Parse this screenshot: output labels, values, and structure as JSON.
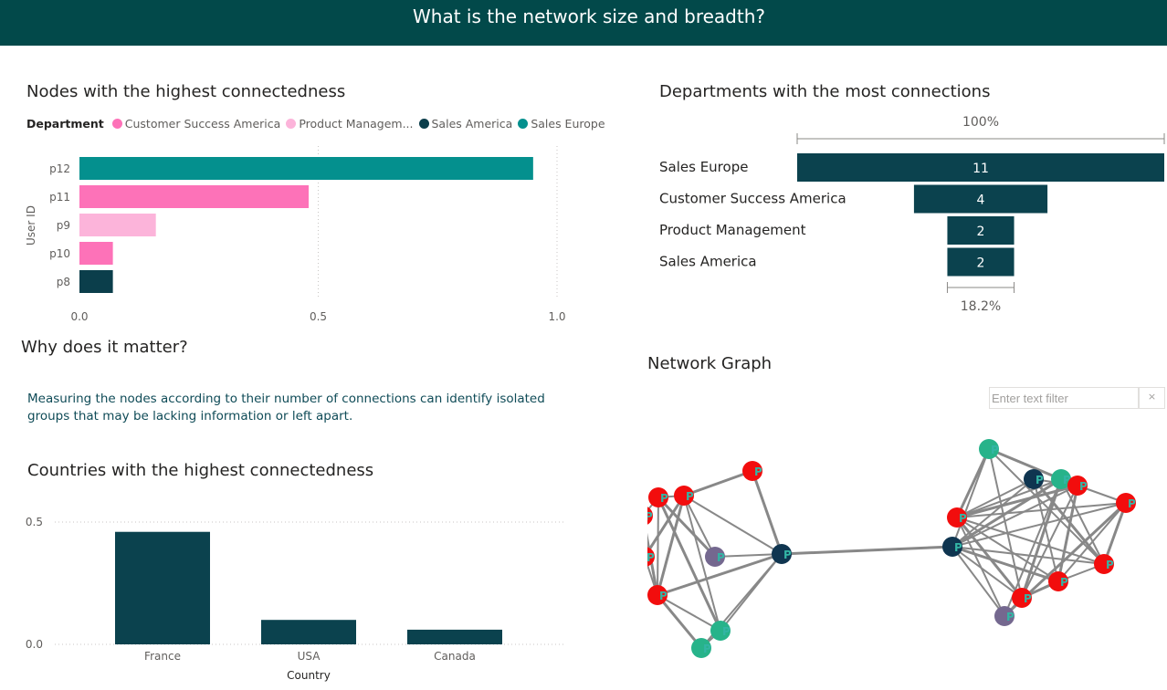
{
  "header": {
    "title": "What is the network size and breadth?"
  },
  "nodes_chart": {
    "title": "Nodes with the highest connectedness",
    "legend_title": "Department",
    "legend": [
      {
        "label": "Customer Success America",
        "color": "#fd72b8"
      },
      {
        "label": "Product Managem...",
        "color": "#fcb4da"
      },
      {
        "label": "Sales America",
        "color": "#0b3e4b"
      },
      {
        "label": "Sales Europe",
        "color": "#04908e"
      }
    ],
    "ylabel": "User ID"
  },
  "dept_chart": {
    "title": "Departments with the most connections",
    "top_pct": "100%",
    "bottom_pct": "18.2%"
  },
  "why": {
    "title": "Why does it matter?",
    "text": "Measuring the nodes according to their number of connections can identify isolated groups that may be lacking information or left apart."
  },
  "country_chart": {
    "title": "Countries with the highest connectedness",
    "xlabel": "Country"
  },
  "network": {
    "title": "Network Graph",
    "filter_placeholder": "Enter text filter",
    "clear_icon": "×",
    "node_colors": {
      "red": "#f20d0d",
      "green": "#27b38a",
      "navy": "#0f3550",
      "purple": "#74688f"
    },
    "labels": [
      "P",
      "P",
      "P",
      "P",
      "P",
      "P",
      "P",
      "P",
      "P",
      "P",
      "P",
      "P",
      "P",
      "P",
      "P",
      "P",
      "P",
      "P",
      "P",
      "P",
      "P",
      "P"
    ]
  },
  "chart_data": [
    {
      "type": "bar",
      "orientation": "horizontal",
      "title": "Nodes with the highest connectedness",
      "ylabel": "User ID",
      "categories": [
        "p12",
        "p11",
        "p9",
        "p10",
        "p8"
      ],
      "values": [
        0.95,
        0.48,
        0.16,
        0.07,
        0.07
      ],
      "departments": [
        "Sales Europe",
        "Customer Success America",
        "Product Management",
        "Customer Success America",
        "Sales America"
      ],
      "colors": [
        "#04908e",
        "#fd72b8",
        "#fcb4da",
        "#fd72b8",
        "#0b3e4b"
      ],
      "xlim": [
        0,
        1
      ],
      "xticks": [
        "0.0",
        "0.5",
        "1.0"
      ],
      "grid": true,
      "legend_position": "top-left"
    },
    {
      "type": "bar",
      "subtype": "funnel",
      "title": "Departments with the most connections",
      "categories": [
        "Sales Europe",
        "Customer Success America",
        "Product Management",
        "Sales America"
      ],
      "values": [
        11,
        4,
        2,
        2
      ],
      "labels": [
        "11",
        "4",
        "2",
        "2"
      ],
      "color": "#0b424e"
    },
    {
      "type": "bar",
      "title": "Countries with the highest connectedness",
      "xlabel": "Country",
      "categories": [
        "France",
        "USA",
        "Canada"
      ],
      "values": [
        0.46,
        0.1,
        0.06
      ],
      "color": "#0b424e",
      "ylim": [
        0,
        0.5
      ],
      "yticks": [
        "0.0",
        "0.5"
      ],
      "grid": true
    }
  ]
}
